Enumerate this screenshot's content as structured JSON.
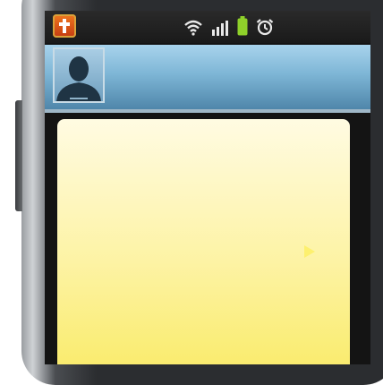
{
  "app": {
    "notification_icon": "red-book-cross-icon",
    "status_icons": [
      "wifi-icon",
      "signal-bars-icon",
      "battery-icon",
      "alarm-clock-icon"
    ],
    "avatar": "profile-silhouette-icon"
  },
  "colors": {
    "status_bar": "#1a1a1a",
    "header_top": "#a8d3ec",
    "header_bottom": "#4f86aa",
    "note_top": "#fffbe2",
    "note_bottom": "#f9eb68",
    "battery": "#8fd12a"
  }
}
